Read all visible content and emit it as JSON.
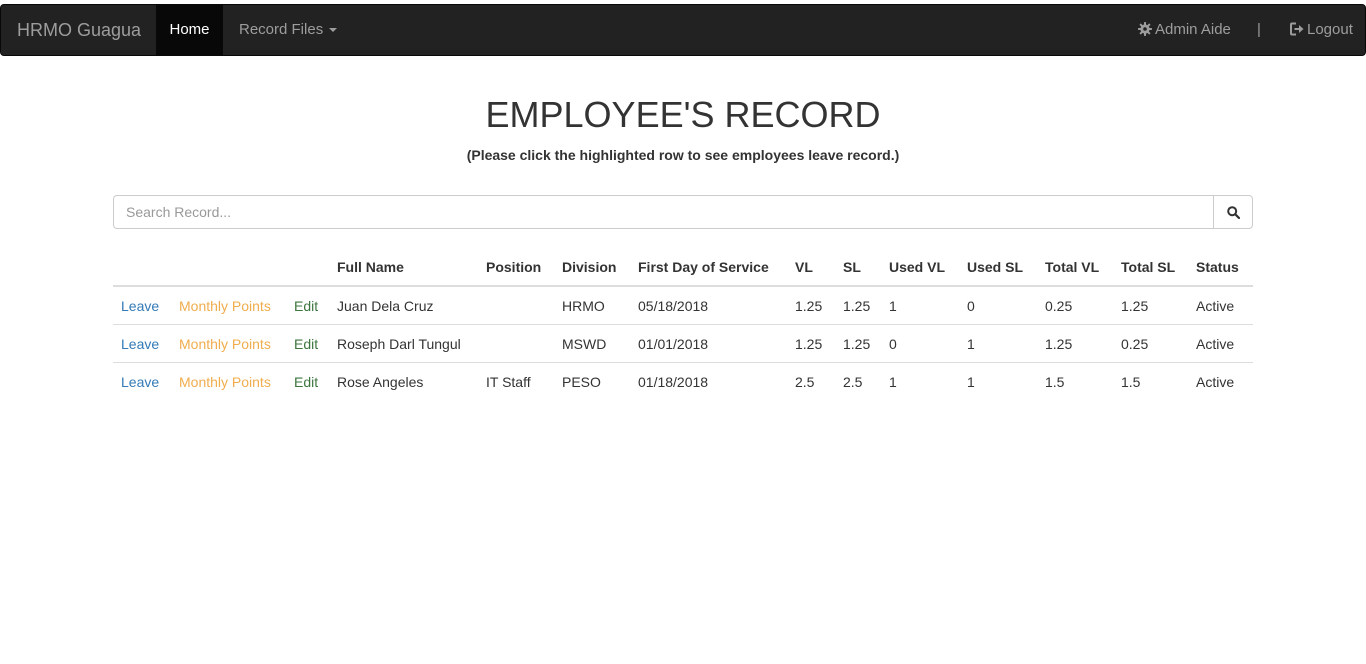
{
  "navbar": {
    "brand": "HRMO Guagua",
    "home_label": "Home",
    "records_label": "Record Files",
    "admin_label": "Admin Aide",
    "separator": "|",
    "logout_label": "Logout"
  },
  "page": {
    "title": "EMPLOYEE'S RECORD",
    "subtitle": "(Please click the highlighted row to see employees leave record.)"
  },
  "search": {
    "placeholder": "Search Record..."
  },
  "table": {
    "headers": [
      "",
      "",
      "",
      "Full Name",
      "Position",
      "Division",
      "First Day of Service",
      "VL",
      "SL",
      "Used VL",
      "Used SL",
      "Total VL",
      "Total SL",
      "Status"
    ],
    "rows": [
      {
        "leave": "Leave",
        "points": "Monthly Points",
        "edit": "Edit",
        "full_name": "Juan Dela Cruz",
        "position": "",
        "division": "HRMO",
        "first_day": "05/18/2018",
        "vl": "1.25",
        "sl": "1.25",
        "used_vl": "1",
        "used_sl": "0",
        "total_vl": "0.25",
        "total_sl": "1.25",
        "status": "Active"
      },
      {
        "leave": "Leave",
        "points": "Monthly Points",
        "edit": "Edit",
        "full_name": "Roseph Darl Tungul",
        "position": "",
        "division": "MSWD",
        "first_day": "01/01/2018",
        "vl": "1.25",
        "sl": "1.25",
        "used_vl": "0",
        "used_sl": "1",
        "total_vl": "1.25",
        "total_sl": "0.25",
        "status": "Active"
      },
      {
        "leave": "Leave",
        "points": "Monthly Points",
        "edit": "Edit",
        "full_name": "Rose Angeles",
        "position": "IT Staff",
        "division": "PESO",
        "first_day": "01/18/2018",
        "vl": "2.5",
        "sl": "2.5",
        "used_vl": "1",
        "used_sl": "1",
        "total_vl": "1.5",
        "total_sl": "1.5",
        "status": "Active"
      }
    ]
  },
  "colors": {
    "navbar_bg": "#222222",
    "active_nav_bg": "#080808",
    "leave_link": "#337ab7",
    "points_link": "#f0ad4e",
    "edit_link": "#3c763d"
  },
  "icons": {
    "admin": "gear-icon",
    "logout": "logout-icon",
    "search": "search-icon",
    "dropdown": "caret-down-icon"
  }
}
